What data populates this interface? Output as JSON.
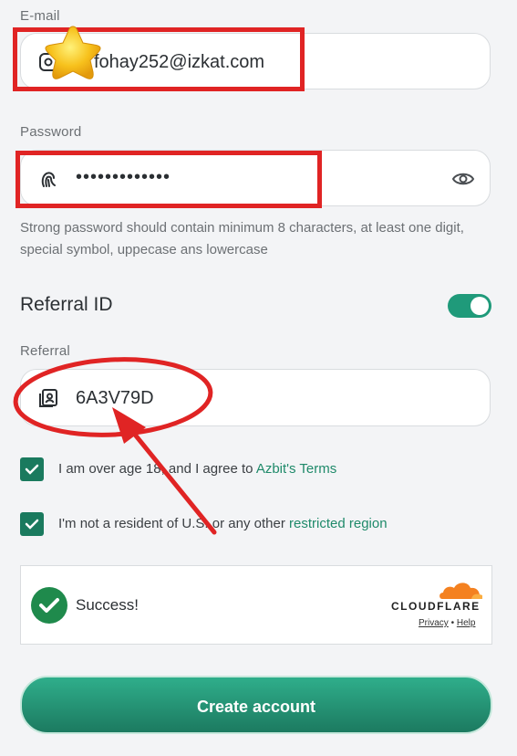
{
  "form": {
    "email_label": "E-mail",
    "email_value": "fohay252@izkat.com",
    "password_label": "Password",
    "password_value": "•••••••••••••",
    "password_hint": "Strong password should contain minimum 8 characters, at least one digit, special symbol, uppecase ans lowercase",
    "referral_toggle_label": "Referral ID",
    "referral_toggle_on": true,
    "referral_label": "Referral",
    "referral_value": "6A3V79D",
    "check1_prefix": "I am over age 18, and I agree to ",
    "check1_link": "Azbit's Terms",
    "check2_prefix": "I'm not a resident of U.S. or any other ",
    "check2_link": "restricted region",
    "submit_label": "Create account"
  },
  "captcha": {
    "status": "Success!",
    "brand": "CLOUDFLARE",
    "privacy": "Privacy",
    "separator": "•",
    "help": "Help"
  },
  "colors": {
    "accent": "#1f9a7a",
    "annotation_red": "#e02424",
    "cloudflare_orange": "#f48120"
  }
}
